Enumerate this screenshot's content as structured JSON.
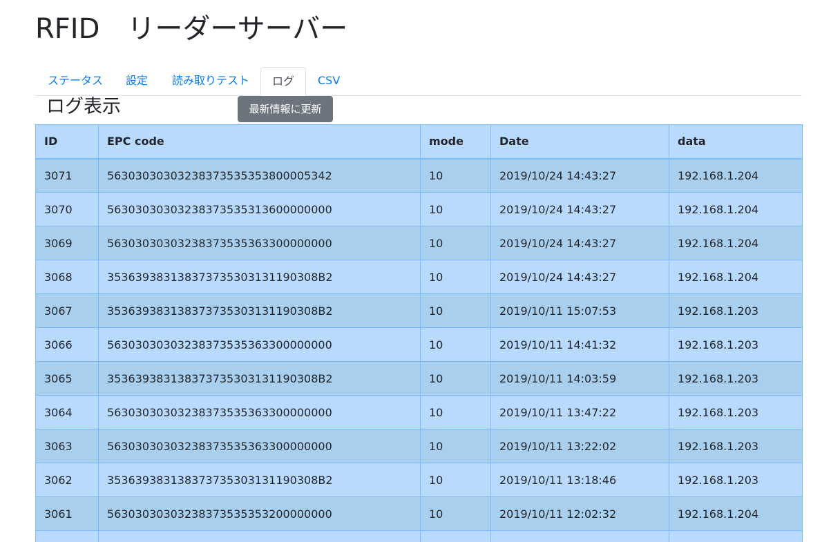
{
  "app": {
    "title": "RFID　リーダーサーバー"
  },
  "tabs": [
    {
      "label": "ステータス"
    },
    {
      "label": "設定"
    },
    {
      "label": "読み取りテスト"
    },
    {
      "label": "ログ"
    },
    {
      "label": "CSV"
    }
  ],
  "main": {
    "section_title": "ログ表示",
    "tooltip": "最新情報に更新"
  },
  "table": {
    "columns": [
      "ID",
      "EPC code",
      "mode",
      "Date",
      "data"
    ],
    "rows": [
      [
        "3071",
        "56303030303238373535353800005342",
        "10",
        "2019/10/24 14:43:27",
        "192.168.1.204"
      ],
      [
        "3070",
        "56303030303238373535313600000000",
        "10",
        "2019/10/24 14:43:27",
        "192.168.1.204"
      ],
      [
        "3069",
        "56303030303238373535363300000000",
        "10",
        "2019/10/24 14:43:27",
        "192.168.1.204"
      ],
      [
        "3068",
        "353639383138373735303131190308B2",
        "10",
        "2019/10/24 14:43:27",
        "192.168.1.204"
      ],
      [
        "3067",
        "353639383138373735303131190308B2",
        "10",
        "2019/10/11 15:07:53",
        "192.168.1.203"
      ],
      [
        "3066",
        "56303030303238373535363300000000",
        "10",
        "2019/10/11 14:41:32",
        "192.168.1.203"
      ],
      [
        "3065",
        "353639383138373735303131190308B2",
        "10",
        "2019/10/11 14:03:59",
        "192.168.1.203"
      ],
      [
        "3064",
        "56303030303238373535363300000000",
        "10",
        "2019/10/11 13:47:22",
        "192.168.1.203"
      ],
      [
        "3063",
        "56303030303238373535363300000000",
        "10",
        "2019/10/11 13:22:02",
        "192.168.1.203"
      ],
      [
        "3062",
        "353639383138373735303131190308B2",
        "10",
        "2019/10/11 13:18:46",
        "192.168.1.203"
      ],
      [
        "3061",
        "56303030303238373535353200000000",
        "10",
        "2019/10/11 12:02:32",
        "192.168.1.204"
      ],
      [
        "",
        "",
        "",
        "",
        ""
      ]
    ]
  }
}
